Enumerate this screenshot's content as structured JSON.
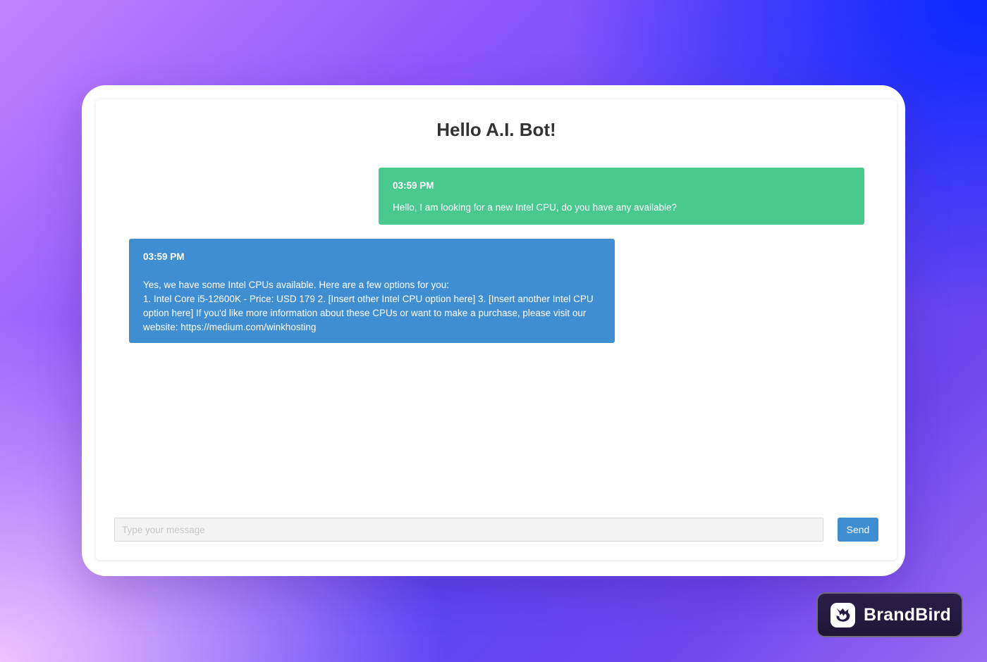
{
  "chat": {
    "title": "Hello A.I. Bot!",
    "messages": [
      {
        "sender": "user",
        "time": "03:59 PM",
        "text": "Hello, I am looking for a new Intel CPU, do you have any available?"
      },
      {
        "sender": "bot",
        "time": "03:59 PM",
        "text": "Yes, we have some Intel CPUs available. Here are a few options for you:",
        "body": "1. Intel Core i5-12600K - Price: USD 179 2. [Insert other Intel CPU option here] 3. [Insert another Intel CPU option here] If you'd like more information about these CPUs or want to make a purchase, please visit our website: https://medium.com/winkhosting"
      }
    ]
  },
  "composer": {
    "value": "",
    "placeholder": "Type your message",
    "send_label": "Send"
  },
  "brand": {
    "name": "BrandBird",
    "logo_icon": "bird-logo-icon"
  },
  "colors": {
    "user_bubble": "#4ac98e",
    "bot_bubble": "#3f8ed1",
    "send_button": "#3f8ed1"
  }
}
